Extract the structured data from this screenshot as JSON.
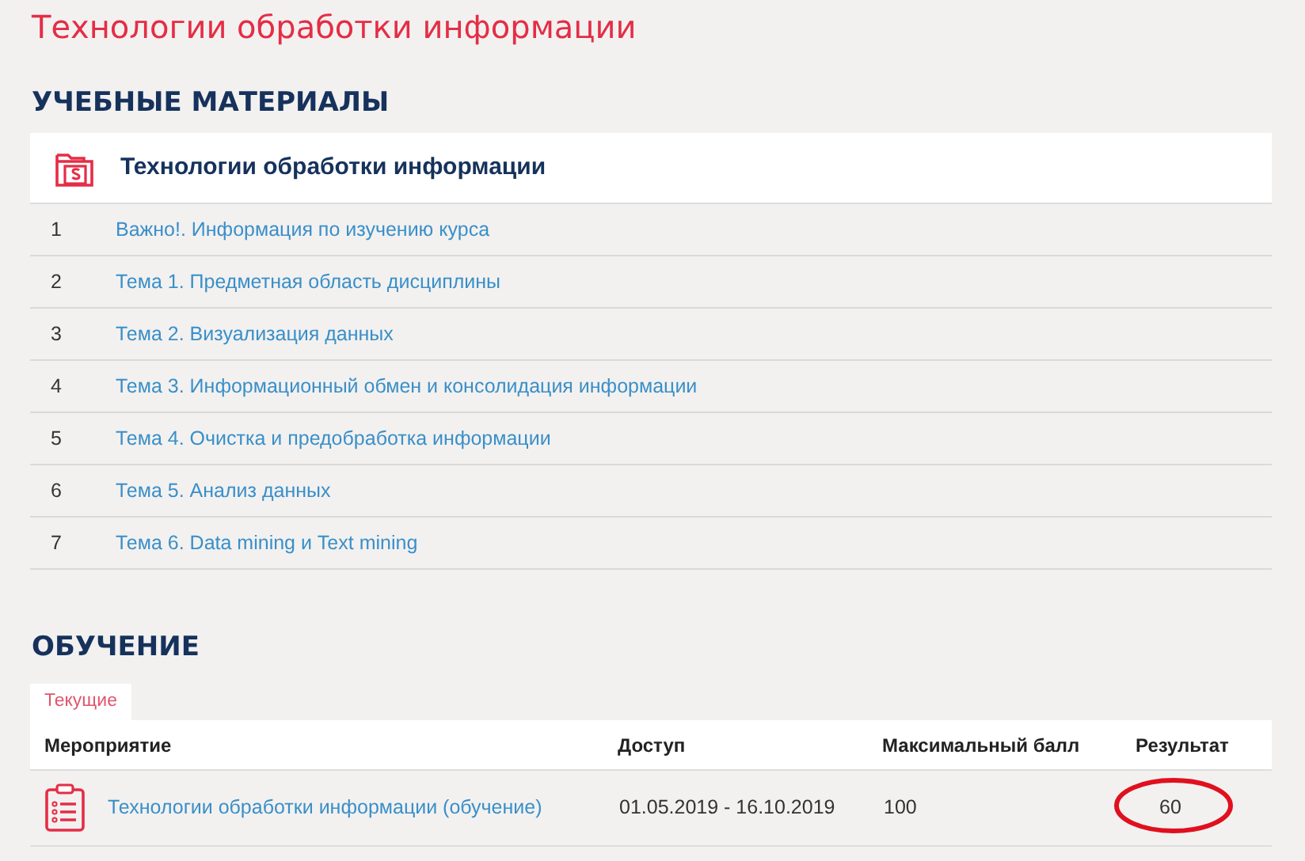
{
  "page_title": "Технологии обработки информации",
  "materials": {
    "heading": "УЧЕБНЫЕ МАТЕРИАЛЫ",
    "course_title": "Технологии обработки информации",
    "items": [
      {
        "number": "1",
        "title": "Важно!. Информация по изучению курса"
      },
      {
        "number": "2",
        "title": "Тема 1. Предметная область дисциплины"
      },
      {
        "number": "3",
        "title": "Тема 2. Визуализация данных"
      },
      {
        "number": "4",
        "title": "Тема 3. Информационный обмен и консолидация информации"
      },
      {
        "number": "5",
        "title": "Тема 4. Очистка и предобработка информации"
      },
      {
        "number": "6",
        "title": "Тема 5. Анализ данных"
      },
      {
        "number": "7",
        "title": "Тема 6. Data mining и Text mining"
      }
    ]
  },
  "training": {
    "heading": "ОБУЧЕНИЕ",
    "tabs": [
      {
        "label": "Текущие",
        "selected": true
      }
    ],
    "columns": [
      "Мероприятие",
      "Доступ",
      "Максимальный балл",
      "Результат"
    ],
    "rows": [
      {
        "event": "Технологии обработки информации (обучение)",
        "access": "01.05.2019 - 16.10.2019",
        "max_score": "100",
        "result": "60",
        "result_circled": true
      }
    ]
  }
}
